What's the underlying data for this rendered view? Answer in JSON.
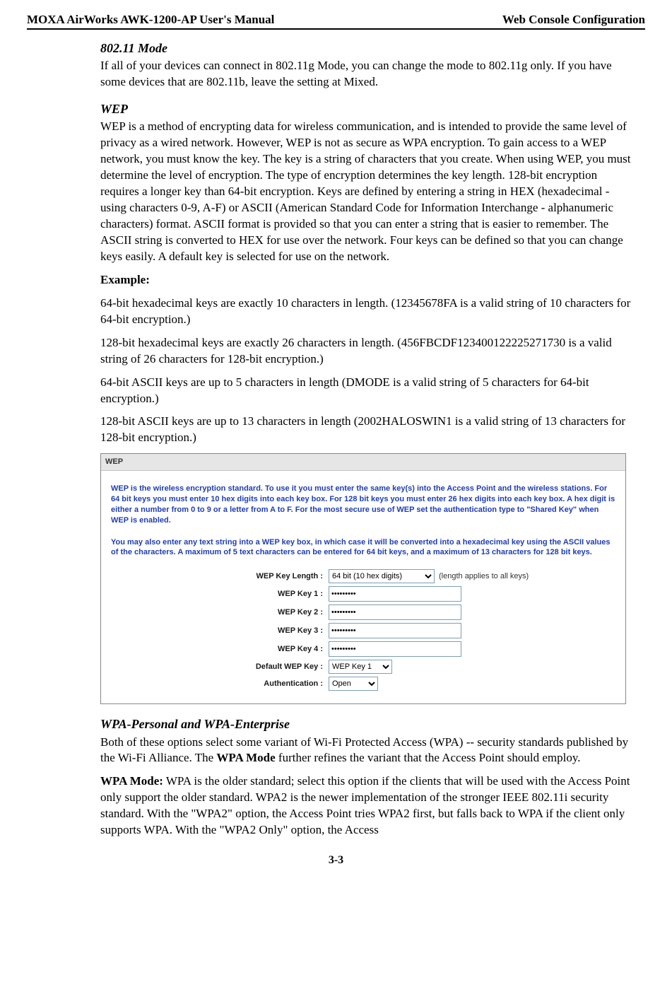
{
  "header": {
    "left": "MOXA AirWorks AWK-1200-AP User's Manual",
    "right": "Web Console Configuration"
  },
  "sections": {
    "s1": {
      "title": "802.11 Mode",
      "p1": "If all of your devices can connect in 802.11g Mode, you can change the mode to 802.11g only. If you have some devices that are 802.11b, leave the setting at Mixed."
    },
    "s2": {
      "title": "WEP",
      "p1": "WEP is a method of encrypting data for wireless communication, and is intended to provide the same level of privacy as a wired network. However, WEP is not as secure as WPA encryption. To gain access to a WEP network, you must know the key. The key is a string of characters that you create. When using WEP, you must determine the level of encryption. The type of encryption determines the key length. 128-bit encryption requires a longer key than 64-bit encryption. Keys are defined by entering a string in HEX (hexadecimal - using characters 0-9, A-F) or ASCII (American Standard Code for Information Interchange - alphanumeric characters) format. ASCII format is provided so that you can enter a string that is easier to remember. The ASCII string is converted to HEX for use over the network. Four keys can be defined so that you can change keys easily. A default key is selected for use on the network.",
      "example_label": "Example:",
      "p2": "64-bit hexadecimal keys are exactly 10 characters in length. (12345678FA is a valid string of 10 characters for 64-bit encryption.)",
      "p3": "128-bit hexadecimal keys are exactly 26 characters in length. (456FBCDF123400122225271730 is a valid string of 26 characters for 128-bit encryption.)",
      "p4": "64-bit ASCII keys are up to 5 characters in length (DMODE is a valid string of 5 characters for 64-bit encryption.)",
      "p5": "128-bit ASCII keys are up to 13 characters in length (2002HALOSWIN1 is a valid string of 13 characters for 128-bit encryption.)"
    },
    "wep_box": {
      "title": "WEP",
      "blurb1": "WEP is the wireless encryption standard. To use it you must enter the same key(s) into the Access Point and the wireless stations. For 64 bit keys you must enter 10 hex digits into each key box. For 128 bit keys you must enter 26 hex digits into each key box. A hex digit is either a number from 0 to 9 or a letter from A to F. For the most secure use of WEP set the authentication type to \"Shared Key\" when WEP is enabled.",
      "blurb2": "You may also enter any text string into a WEP key box, in which case it will be converted into a hexadecimal key using the ASCII values of the characters. A maximum of 5 text characters can be entered for 64 bit keys, and a maximum of 13 characters for 128 bit keys.",
      "fields": {
        "key_length_label": "WEP Key Length :",
        "key_length_value": "64 bit (10 hex digits)",
        "key_length_note": "(length applies to all keys)",
        "key1_label": "WEP Key 1 :",
        "key1_value": "•••••••••",
        "key2_label": "WEP Key 2 :",
        "key2_value": "•••••••••",
        "key3_label": "WEP Key 3 :",
        "key3_value": "•••••••••",
        "key4_label": "WEP Key 4 :",
        "key4_value": "•••••••••",
        "default_key_label": "Default WEP Key :",
        "default_key_value": "WEP Key 1",
        "auth_label": "Authentication :",
        "auth_value": "Open"
      }
    },
    "s3": {
      "title": "WPA-Personal and WPA-Enterprise",
      "p1_a": "Both of these options select some variant of Wi-Fi Protected Access (WPA) -- security standards published by the Wi-Fi Alliance. The ",
      "p1_bold": "WPA Mode",
      "p1_b": " further refines the variant that the Access Point should employ.",
      "p2_bold": "WPA Mode:",
      "p2": " WPA is the older standard; select this option if the clients that will be used with the Access Point only support the older standard. WPA2 is the newer implementation of the stronger IEEE 802.11i security standard. With the \"WPA2\" option, the Access Point tries WPA2 first, but falls back to WPA if the client only supports WPA. With the \"WPA2 Only\" option, the Access"
    }
  },
  "footer": "3-3"
}
